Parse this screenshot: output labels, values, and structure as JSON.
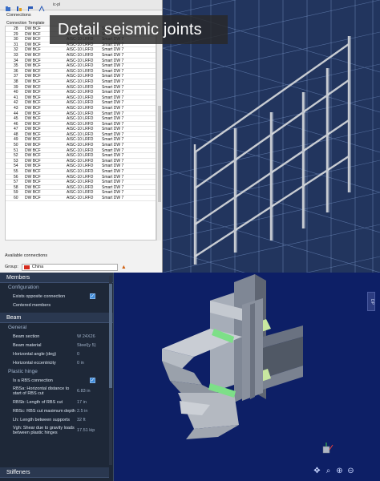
{
  "window": {
    "toolbar_text": "ic-pl"
  },
  "banner": {
    "title": "Detail seismic joints"
  },
  "connections": {
    "title": "Connections",
    "headers": [
      "Connection",
      "Template"
    ],
    "rows": [
      {
        "num": "28",
        "template": "DW BCF",
        "code": "AISC-10 LRFD",
        "mode": "Smart DW 7"
      },
      {
        "num": "29",
        "template": "DW BCF",
        "code": "AISC-10 LRFD",
        "mode": "Smart DW 7"
      },
      {
        "num": "30",
        "template": "DW BCF",
        "code": "AISC-10 LRFD",
        "mode": "Smart DW 7"
      },
      {
        "num": "31",
        "template": "DW BCF",
        "code": "AISC-10 LRFD",
        "mode": "Smart DW 7"
      },
      {
        "num": "32",
        "template": "DW BCF",
        "code": "AISC-10 LRFD",
        "mode": "Smart DW 7"
      },
      {
        "num": "33",
        "template": "DW BCF",
        "code": "AISC-10 LRFD",
        "mode": "Smart DW 7"
      },
      {
        "num": "34",
        "template": "DW BCF",
        "code": "AISC-10 LRFD",
        "mode": "Smart DW 7"
      },
      {
        "num": "35",
        "template": "DW BCF",
        "code": "AISC-10 LRFD",
        "mode": "Smart DW 7"
      },
      {
        "num": "36",
        "template": "DW BCF",
        "code": "AISC-10 LRFD",
        "mode": "Smart DW 7"
      },
      {
        "num": "37",
        "template": "DW BCF",
        "code": "AISC-10 LRFD",
        "mode": "Smart DW 7"
      },
      {
        "num": "38",
        "template": "DW BCF",
        "code": "AISC-10 LRFD",
        "mode": "Smart DW 7"
      },
      {
        "num": "39",
        "template": "DW BCF",
        "code": "AISC-10 LRFD",
        "mode": "Smart DW 7"
      },
      {
        "num": "40",
        "template": "DW BCF",
        "code": "AISC-10 LRFD",
        "mode": "Smart DW 7"
      },
      {
        "num": "41",
        "template": "DW BCF",
        "code": "AISC-10 LRFD",
        "mode": "Smart DW 7"
      },
      {
        "num": "42",
        "template": "DW BCF",
        "code": "AISC-10 LRFD",
        "mode": "Smart DW 7"
      },
      {
        "num": "43",
        "template": "DW BCF",
        "code": "AISC-10 LRFD",
        "mode": "Smart DW 7"
      },
      {
        "num": "44",
        "template": "DW BCF",
        "code": "AISC-10 LRFD",
        "mode": "Smart DW 7"
      },
      {
        "num": "45",
        "template": "DW BCF",
        "code": "AISC-10 LRFD",
        "mode": "Smart DW 7"
      },
      {
        "num": "46",
        "template": "DW BCF",
        "code": "AISC-10 LRFD",
        "mode": "Smart DW 7"
      },
      {
        "num": "47",
        "template": "DW BCF",
        "code": "AISC-10 LRFD",
        "mode": "Smart DW 7"
      },
      {
        "num": "48",
        "template": "DW BCF",
        "code": "AISC-10 LRFD",
        "mode": "Smart DW 7"
      },
      {
        "num": "49",
        "template": "DW BCF",
        "code": "AISC-10 LRFD",
        "mode": "Smart DW 7"
      },
      {
        "num": "50",
        "template": "DW BCF",
        "code": "AISC-10 LRFD",
        "mode": "Smart DW 7"
      },
      {
        "num": "51",
        "template": "DW BCF",
        "code": "AISC-10 LRFD",
        "mode": "Smart DW 7"
      },
      {
        "num": "52",
        "template": "DW BCF",
        "code": "AISC-10 LRFD",
        "mode": "Smart DW 7"
      },
      {
        "num": "53",
        "template": "DW BCF",
        "code": "AISC-10 LRFD",
        "mode": "Smart DW 7"
      },
      {
        "num": "54",
        "template": "DW BCF",
        "code": "AISC-10 LRFD",
        "mode": "Smart DW 7"
      },
      {
        "num": "55",
        "template": "DW BCF",
        "code": "AISC-10 LRFD",
        "mode": "Smart DW 7"
      },
      {
        "num": "56",
        "template": "DW BCF",
        "code": "AISC-10 LRFD",
        "mode": "Smart DW 7"
      },
      {
        "num": "57",
        "template": "DW BCF",
        "code": "AISC-10 LRFD",
        "mode": "Smart DW 7"
      },
      {
        "num": "58",
        "template": "DW BCF",
        "code": "AISC-10 LRFD",
        "mode": "Smart DW 7"
      },
      {
        "num": "59",
        "template": "DW BCF",
        "code": "AISC-10 LRFD",
        "mode": "Smart DW 7"
      },
      {
        "num": "60",
        "template": "DW BCF",
        "code": "AISC-10 LRFD",
        "mode": "Smart DW 7"
      }
    ],
    "available_label": "Available connections",
    "group_label": "Group:",
    "group_value": "China"
  },
  "properties": {
    "members": "Members",
    "configuration": "Configuration",
    "exists_opposite": "Exists opposite connection",
    "centered_members": "Centered members",
    "beam": "Beam",
    "general": "General",
    "beam_section_label": "Beam section",
    "beam_section_value": "W 24X26",
    "beam_material_label": "Beam material",
    "beam_material_value": "Steel(y 5)",
    "horiz_angle_label": "Horizontal angle (deg)",
    "horiz_angle_value": "0",
    "horiz_ecc_label": "Horizontal eccentricity",
    "horiz_ecc_value": "0 in",
    "plastic_hinge": "Plastic hinge",
    "rbs_label": "Is a RBS connection",
    "rbs_a_label": "RBSa: Horizontal distance to start of RBS cut",
    "rbs_a_value": "6.83 in",
    "rbs_b_label": "RBSb: Length of RBS cut",
    "rbs_b_value": "17 in",
    "rbs_c_label": "RBSc: RBS cut maximum depth",
    "rbs_c_value": "2.5 in",
    "lh_label": "Lh: Length between supports",
    "lh_value": "32 ft",
    "vgh_label": "Vgh: Shear due to gravity loads between plastic hinges",
    "vgh_value": "17.51 kip",
    "stiffeners": "Stiffeners"
  },
  "viewport": {
    "side_tab": "DP"
  }
}
